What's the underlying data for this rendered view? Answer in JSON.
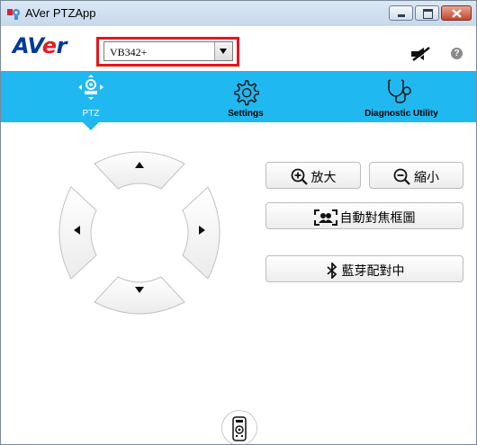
{
  "window": {
    "title": "AVer PTZApp",
    "icons": {
      "app": "app-camera-icon",
      "minimize": "minimize-icon",
      "maximize": "maximize-icon",
      "close": "close-icon"
    }
  },
  "header": {
    "logo": {
      "part1": "AV",
      "part2": "e",
      "part3": "r"
    },
    "model_select": {
      "selected": "VB342+"
    },
    "icons": {
      "camera_status": "camera-off-icon",
      "help": "help-icon"
    },
    "colors": {
      "highlight_box": "#e8141c",
      "logo_blue": "#003a9a",
      "logo_red": "#e0202a"
    }
  },
  "nav": {
    "tabs": [
      {
        "label": "PTZ",
        "icon": "ptz-icon",
        "active": true
      },
      {
        "label": "Settings",
        "icon": "gear-icon",
        "active": false
      },
      {
        "label": "Diagnostic Utility",
        "icon": "stethoscope-icon",
        "active": false
      }
    ],
    "colors": {
      "bar": "#20b8f0"
    }
  },
  "ptz": {
    "dpad": {
      "icons": [
        "up-arrow-icon",
        "left-arrow-icon",
        "right-arrow-icon",
        "down-arrow-icon"
      ]
    },
    "zoom_in_label": "放大",
    "zoom_out_label": "縮小",
    "auto_frame_label": "自動對焦框圖",
    "bluetooth_label": "藍芽配對中",
    "icons": {
      "zoom_in": "zoom-in-icon",
      "zoom_out": "zoom-out-icon",
      "auto_frame": "auto-frame-icon",
      "bluetooth": "bluetooth-icon",
      "remote": "remote-control-icon"
    }
  }
}
